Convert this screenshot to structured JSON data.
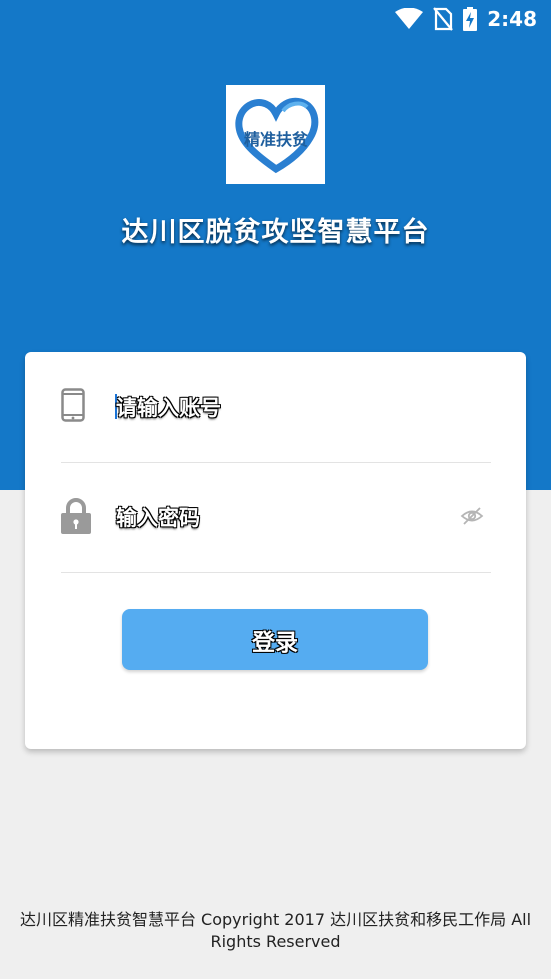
{
  "status_bar": {
    "time": "2:48",
    "icons": [
      "wifi-icon",
      "no-sim-icon",
      "battery-charging-icon"
    ]
  },
  "header": {
    "logo_text": "精准扶贫",
    "title": "达川区脱贫攻坚智慧平台"
  },
  "login": {
    "account_placeholder": "请输入账号",
    "password_placeholder": "输入密码",
    "submit_label": "登录"
  },
  "footer": {
    "copyright": "达川区精准扶贫智慧平台 Copyright 2017 达川区扶贫和移民工作局 All Rights Reserved"
  },
  "colors": {
    "brand_blue": "#1478c8",
    "button_blue": "#55acf1",
    "page_bg": "#efefef",
    "logo_heart": "#2a7fd1"
  }
}
